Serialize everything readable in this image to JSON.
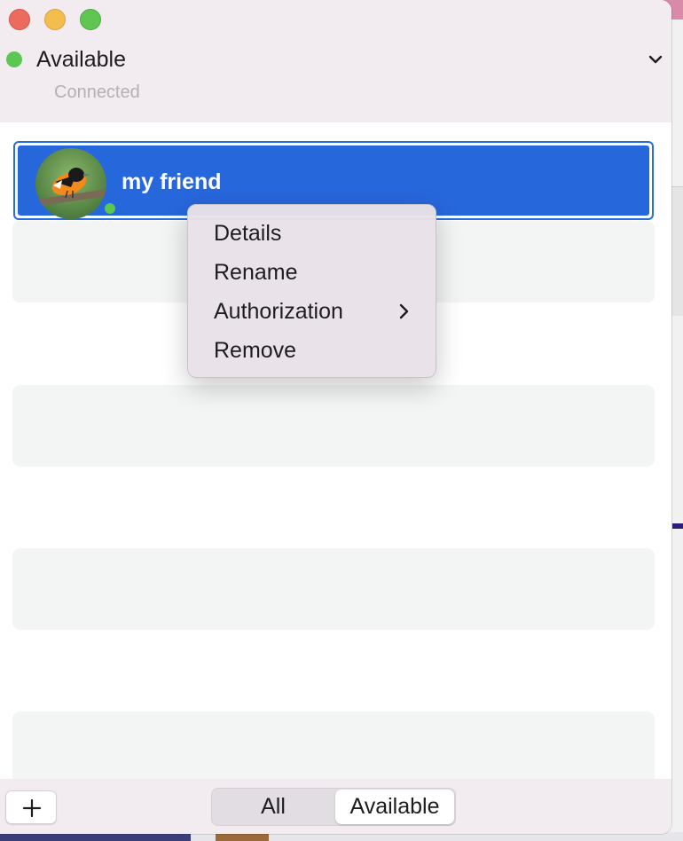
{
  "window": {
    "controls": [
      "close",
      "minimize",
      "maximize"
    ]
  },
  "status": {
    "label": "Available",
    "subtitle": "Connected",
    "dot_color": "#5cc653",
    "dropdown_icon": "chevron-down-icon"
  },
  "contacts": [
    {
      "name": "my friend",
      "avatar": "bird-avatar",
      "presence": "available",
      "selected": true
    }
  ],
  "context_menu": {
    "items": [
      {
        "label": "Details"
      },
      {
        "label": "Rename"
      },
      {
        "label": "Authorization",
        "has_submenu": true
      },
      {
        "label": "Remove"
      }
    ]
  },
  "footer": {
    "add_icon": "plus-icon",
    "filter": {
      "options": [
        "All",
        "Available"
      ],
      "selected": "Available"
    }
  },
  "colors": {
    "selection": "#2767dc",
    "presence_green": "#5cc653",
    "header_bg": "#f2ebf0"
  }
}
